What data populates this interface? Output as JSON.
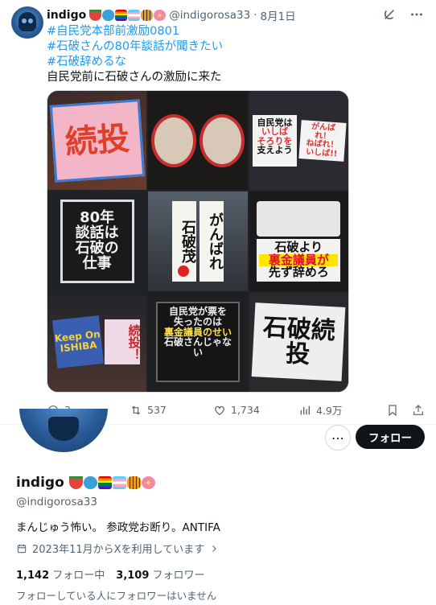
{
  "tweet": {
    "author_name": "indigo",
    "author_handle": "@indigorosa33",
    "date": "8月1日",
    "hashtags": [
      "#自民党本部前激励0801",
      "#石破さんの80年談話が聞きたい",
      "#石破辞めるな"
    ],
    "body": "自民党前に石破さんの激励に来た",
    "images": {
      "c1": "続投",
      "c4": [
        "80年",
        "談話は",
        "石破の",
        "仕事"
      ],
      "c5_a": "石破茂",
      "c5_b": "がんばれ",
      "c6_a": "石破より",
      "c6_b": "裏金議員が",
      "c6_c": "先ず辞めろ",
      "c3_a": [
        "自民党は",
        "いしば",
        "そろりを",
        "支えよう"
      ],
      "c3_b": [
        "がんばれ！",
        "ねばれ！",
        "いしば!!"
      ],
      "c7_a": [
        "Keep On",
        "ISHIBA"
      ],
      "c7_b": "続投！",
      "c8": [
        "自民党が票を",
        "失ったのは",
        "裏金議員のせい",
        "石破さんじゃない"
      ],
      "c9": "石破続投"
    },
    "stats": {
      "replies": "3",
      "retweets": "537",
      "likes": "1,734",
      "views": "4.9万"
    }
  },
  "profile": {
    "name": "indigo",
    "handle": "@indigorosa33",
    "bio": "まんじゅう怖い。 参政党お断り。ANTIFA",
    "joined": "2023年11月からXを利用しています",
    "following_count": "1,142",
    "following_label": "フォロー中",
    "followers_count": "3,109",
    "followers_label": "フォロワー",
    "note": "フォローしている人にフォロワーはいません",
    "follow_button": "フォロー"
  },
  "emoji_colors": [
    "#e2433a",
    "#3aa0d8",
    "#8a5fd0",
    "#f5a9b8",
    "#e89a2a",
    "#f08aa8"
  ],
  "icons": [
    "grok-icon",
    "more-icon",
    "reply-icon",
    "retweet-icon",
    "like-icon",
    "views-icon",
    "bookmark-icon",
    "share-icon",
    "calendar-icon",
    "chevron-right-icon"
  ]
}
